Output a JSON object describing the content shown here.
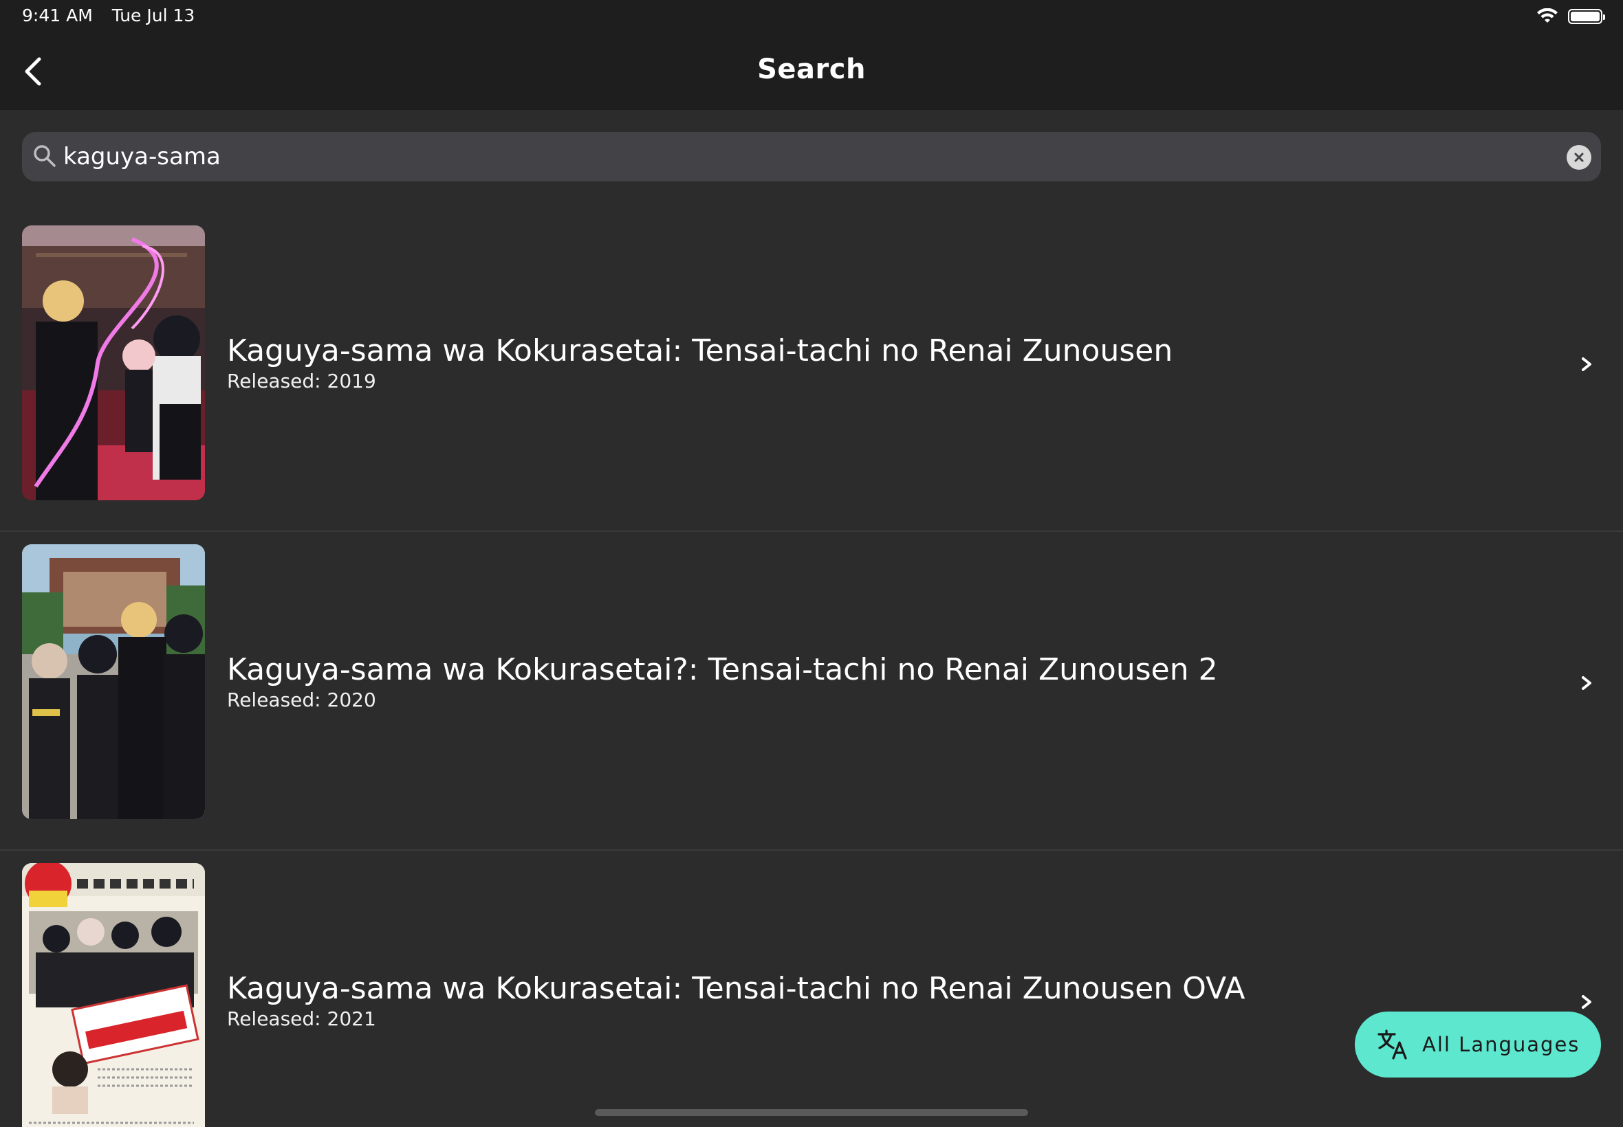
{
  "status_bar": {
    "time": "9:41 AM",
    "date": "Tue Jul 13"
  },
  "header": {
    "title": "Search"
  },
  "search": {
    "value": "kaguya-sama",
    "placeholder": ""
  },
  "results": [
    {
      "title": "Kaguya-sama wa Kokurasetai: Tensai-tachi no Renai Zunousen",
      "released": "Released: 2019",
      "poster": "poster-season-1"
    },
    {
      "title": "Kaguya-sama wa Kokurasetai?: Tensai-tachi no Renai Zunousen 2",
      "released": "Released: 2020",
      "poster": "poster-season-2"
    },
    {
      "title": "Kaguya-sama wa Kokurasetai: Tensai-tachi no Renai Zunousen OVA",
      "released": "Released: 2021",
      "poster": "poster-ova"
    }
  ],
  "language_button": {
    "label": "All Languages",
    "icon": "translate-icon"
  },
  "colors": {
    "accent": "#5de7cf",
    "background": "#2c2c2c",
    "header": "#1e1e1e",
    "search_bg": "#424247"
  }
}
